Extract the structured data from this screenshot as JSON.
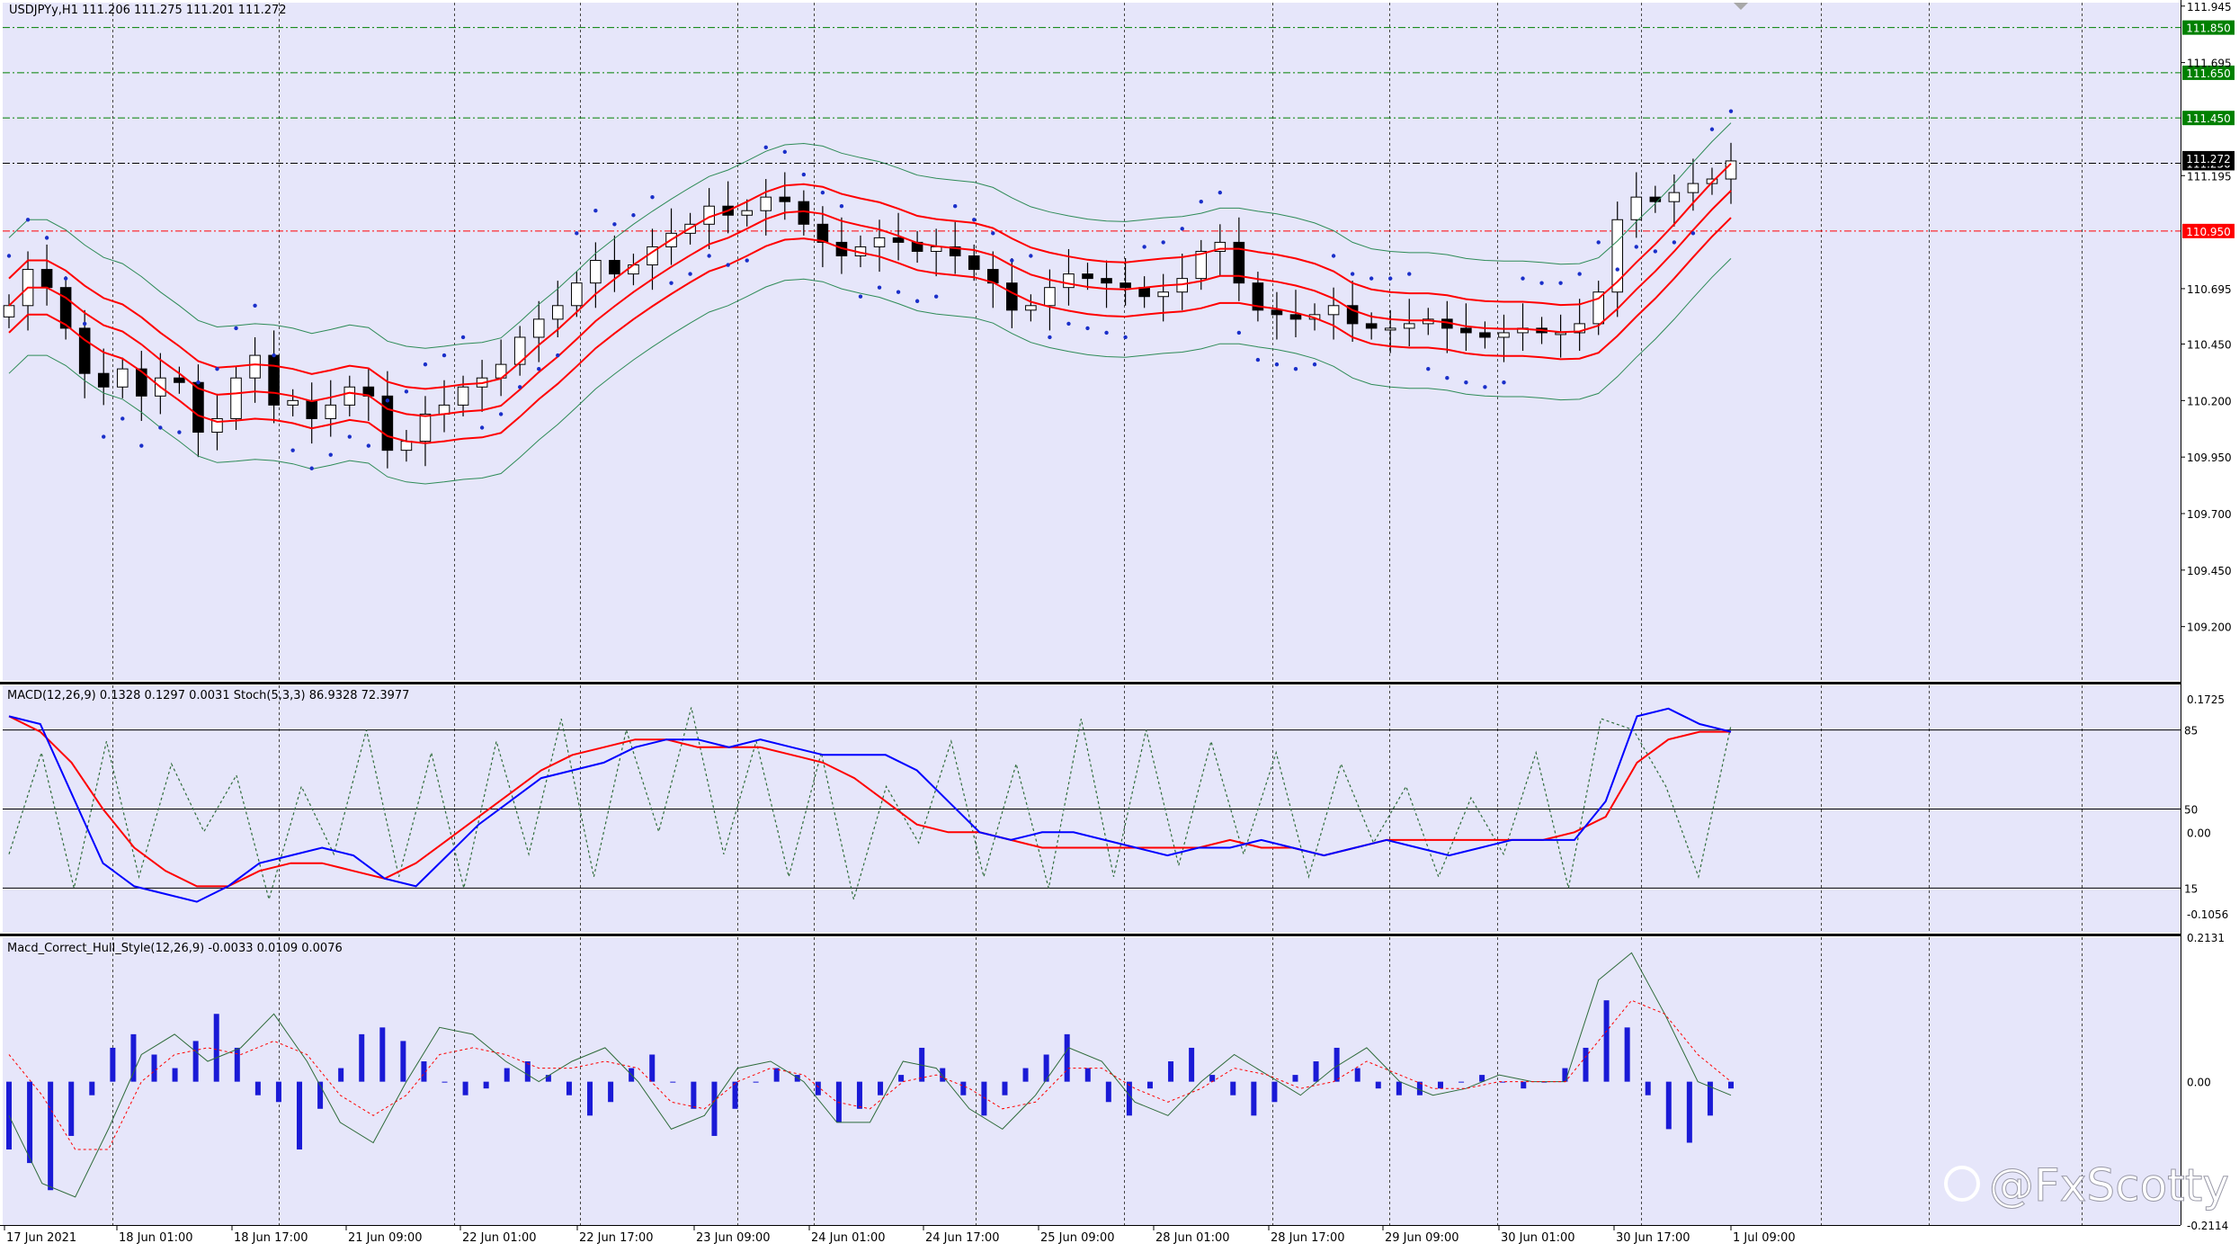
{
  "header": {
    "symbol_line": "USDJPYy,H1  111.206 111.275 111.201 111.272",
    "macd_line": "MACD(12,26,9) 0.1328 0.1297 0.0031  Stoch(5,3,3) 86.9328 72.3977",
    "hull_line": "Macd_Correct_Hull_Style(12,26,9) -0.0033 0.0109 0.0076"
  },
  "watermark": "@FxScotty",
  "colors": {
    "pane_bg": "#e6e6fa",
    "candle": "#000000",
    "envelope": "#ff0000",
    "bollinger": "#2e8b57",
    "psar": "#1a2fc9",
    "macd_main": "#0000ff",
    "macd_signal": "#ff0000",
    "stoch": "#2e6b3a",
    "histogram": "#1a1ad6",
    "level_green": "#008000",
    "level_red": "#ff0000"
  },
  "chart_data": [
    {
      "type": "candlestick",
      "name": "price",
      "ylim": [
        108.96,
        111.96
      ],
      "price_ticks": [
        "111.945",
        "111.695",
        "111.195",
        "110.695",
        "110.450",
        "110.200",
        "109.950",
        "109.700",
        "109.450",
        "109.200"
      ],
      "levels": [
        {
          "label": "111.850",
          "value": 111.85,
          "color": "#008000"
        },
        {
          "label": "111.650",
          "value": 111.65,
          "color": "#008000"
        },
        {
          "label": "111.450",
          "value": 111.45,
          "color": "#008000"
        },
        {
          "label": "111.250",
          "value": 111.25,
          "color": "#000000"
        },
        {
          "label": "111.272",
          "value": 111.272,
          "color": "#000000"
        },
        {
          "label": "110.950",
          "value": 110.95,
          "color": "#ff0000"
        }
      ],
      "close": [
        110.62,
        110.78,
        110.7,
        110.52,
        110.32,
        110.26,
        110.34,
        110.22,
        110.3,
        110.28,
        110.06,
        110.12,
        110.3,
        110.4,
        110.18,
        110.2,
        110.12,
        110.18,
        110.26,
        110.22,
        109.98,
        110.02,
        110.14,
        110.18,
        110.26,
        110.3,
        110.36,
        110.48,
        110.56,
        110.62,
        110.72,
        110.82,
        110.76,
        110.8,
        110.88,
        110.94,
        110.98,
        111.06,
        111.02,
        111.04,
        111.1,
        111.08,
        110.98,
        110.9,
        110.84,
        110.88,
        110.92,
        110.9,
        110.86,
        110.88,
        110.84,
        110.78,
        110.72,
        110.6,
        110.62,
        110.7,
        110.76,
        110.74,
        110.72,
        110.7,
        110.66,
        110.68,
        110.74,
        110.86,
        110.9,
        110.72,
        110.6,
        110.58,
        110.56,
        110.58,
        110.62,
        110.54,
        110.52,
        110.52,
        110.54,
        110.56,
        110.52,
        110.5,
        110.48,
        110.5,
        110.52,
        110.5,
        110.5,
        110.54,
        110.68,
        111.0,
        111.1,
        111.08,
        111.12,
        111.16,
        111.18,
        111.26
      ],
      "x_ticks": [
        "17 Jun 2021",
        "18 Jun 01:00",
        "18 Jun 17:00",
        "21 Jun 09:00",
        "22 Jun 01:00",
        "22 Jun 17:00",
        "23 Jun 09:00",
        "24 Jun 01:00",
        "24 Jun 17:00",
        "25 Jun 09:00",
        "28 Jun 01:00",
        "28 Jun 17:00",
        "29 Jun 09:00",
        "30 Jun 01:00",
        "30 Jun 17:00",
        "1 Jul 09:00"
      ]
    },
    {
      "type": "line",
      "name": "MACD + Stochastic",
      "ylim": [
        -0.13,
        0.19
      ],
      "ticks": [
        "0.1725",
        "0.00",
        "-0.1056"
      ],
      "stoch_levels": [
        "85",
        "50",
        "15"
      ],
      "stoch_level_values": [
        85,
        50,
        15
      ],
      "series": [
        {
          "values": [
            0.15,
            0.14,
            0.05,
            -0.04,
            -0.07,
            -0.08,
            -0.09,
            -0.07,
            -0.04,
            -0.03,
            -0.02,
            -0.03,
            -0.06,
            -0.07,
            -0.03,
            0.01,
            0.04,
            0.07,
            0.08,
            0.09,
            0.11,
            0.12,
            0.12,
            0.11,
            0.12,
            0.11,
            0.1,
            0.1,
            0.1,
            0.08,
            0.04,
            0.0,
            -0.01,
            0.0,
            0.0,
            -0.01,
            -0.02,
            -0.03,
            -0.02,
            -0.02,
            -0.01,
            -0.02,
            -0.03,
            -0.02,
            -0.01,
            -0.02,
            -0.03,
            -0.02,
            -0.01,
            -0.01,
            -0.01,
            0.04,
            0.15,
            0.16,
            0.14,
            0.13
          ]
        },
        {
          "values": [
            0.15,
            0.13,
            0.09,
            0.03,
            -0.02,
            -0.05,
            -0.07,
            -0.07,
            -0.05,
            -0.04,
            -0.04,
            -0.05,
            -0.06,
            -0.04,
            -0.01,
            0.02,
            0.05,
            0.08,
            0.1,
            0.11,
            0.12,
            0.12,
            0.11,
            0.11,
            0.11,
            0.1,
            0.09,
            0.07,
            0.04,
            0.01,
            0.0,
            0.0,
            -0.01,
            -0.02,
            -0.02,
            -0.02,
            -0.02,
            -0.02,
            -0.02,
            -0.01,
            -0.02,
            -0.02,
            -0.03,
            -0.02,
            -0.01,
            -0.01,
            -0.01,
            -0.01,
            -0.01,
            -0.01,
            0.0,
            0.02,
            0.09,
            0.12,
            0.13,
            0.13
          ]
        },
        {
          "values": [
            30,
            75,
            15,
            80,
            20,
            70,
            40,
            65,
            10,
            60,
            30,
            85,
            20,
            75,
            15,
            80,
            30,
            90,
            20,
            85,
            40,
            95,
            30,
            80,
            20,
            75,
            10,
            60,
            35,
            80,
            20,
            70,
            15,
            90,
            20,
            85,
            25,
            80,
            30,
            75,
            20,
            70,
            35,
            60,
            20,
            55,
            30,
            75,
            15,
            90,
            85,
            60,
            20,
            87
          ]
        }
      ]
    },
    {
      "type": "bar",
      "name": "Macd_Correct_Hull_Style histogram",
      "ylim": [
        -0.2114,
        0.2131
      ],
      "ticks": [
        "0.2131",
        "0.00",
        "-0.2114"
      ],
      "values": [
        -0.1,
        -0.12,
        -0.16,
        -0.08,
        -0.02,
        0.05,
        0.07,
        0.04,
        0.02,
        0.06,
        0.1,
        0.05,
        -0.02,
        -0.03,
        -0.1,
        -0.04,
        0.02,
        0.07,
        0.08,
        0.06,
        0.03,
        0.0,
        -0.02,
        -0.01,
        0.02,
        0.03,
        0.01,
        -0.02,
        -0.05,
        -0.03,
        0.02,
        0.04,
        0.0,
        -0.04,
        -0.08,
        -0.04,
        0.0,
        0.02,
        0.01,
        -0.02,
        -0.06,
        -0.04,
        -0.02,
        0.01,
        0.05,
        0.02,
        -0.02,
        -0.05,
        -0.02,
        0.02,
        0.04,
        0.07,
        0.02,
        -0.03,
        -0.05,
        -0.01,
        0.03,
        0.05,
        0.01,
        -0.02,
        -0.05,
        -0.03,
        0.01,
        0.03,
        0.05,
        0.02,
        -0.01,
        -0.02,
        -0.02,
        -0.01,
        0.0,
        0.01,
        0.0,
        -0.01,
        0.0,
        0.02,
        0.05,
        0.12,
        0.08,
        -0.02,
        -0.07,
        -0.09,
        -0.05,
        -0.01
      ],
      "series": [
        {
          "values": [
            -0.05,
            -0.15,
            -0.17,
            -0.07,
            0.04,
            0.07,
            0.03,
            0.05,
            0.1,
            0.03,
            -0.06,
            -0.09,
            0.0,
            0.08,
            0.07,
            0.03,
            0.0,
            0.03,
            0.05,
            0.0,
            -0.07,
            -0.05,
            0.02,
            0.03,
            0.0,
            -0.06,
            -0.06,
            0.03,
            0.02,
            -0.04,
            -0.07,
            -0.02,
            0.05,
            0.03,
            -0.03,
            -0.05,
            0.0,
            0.04,
            0.01,
            -0.02,
            0.02,
            0.05,
            0.0,
            -0.02,
            -0.01,
            0.01,
            0.0,
            0.0,
            0.15,
            0.19,
            0.1,
            0.0,
            -0.02
          ]
        },
        {
          "values": [
            0.04,
            -0.02,
            -0.1,
            -0.1,
            0.0,
            0.04,
            0.05,
            0.04,
            0.06,
            0.04,
            -0.02,
            -0.05,
            -0.02,
            0.04,
            0.05,
            0.04,
            0.02,
            0.02,
            0.03,
            0.02,
            -0.03,
            -0.04,
            0.0,
            0.02,
            0.01,
            -0.03,
            -0.04,
            0.0,
            0.01,
            -0.01,
            -0.04,
            -0.03,
            0.02,
            0.02,
            -0.01,
            -0.03,
            -0.01,
            0.02,
            0.01,
            -0.01,
            0.0,
            0.03,
            0.01,
            -0.01,
            -0.01,
            0.0,
            0.0,
            0.0,
            0.06,
            0.12,
            0.1,
            0.04,
            0.0
          ]
        }
      ]
    }
  ]
}
